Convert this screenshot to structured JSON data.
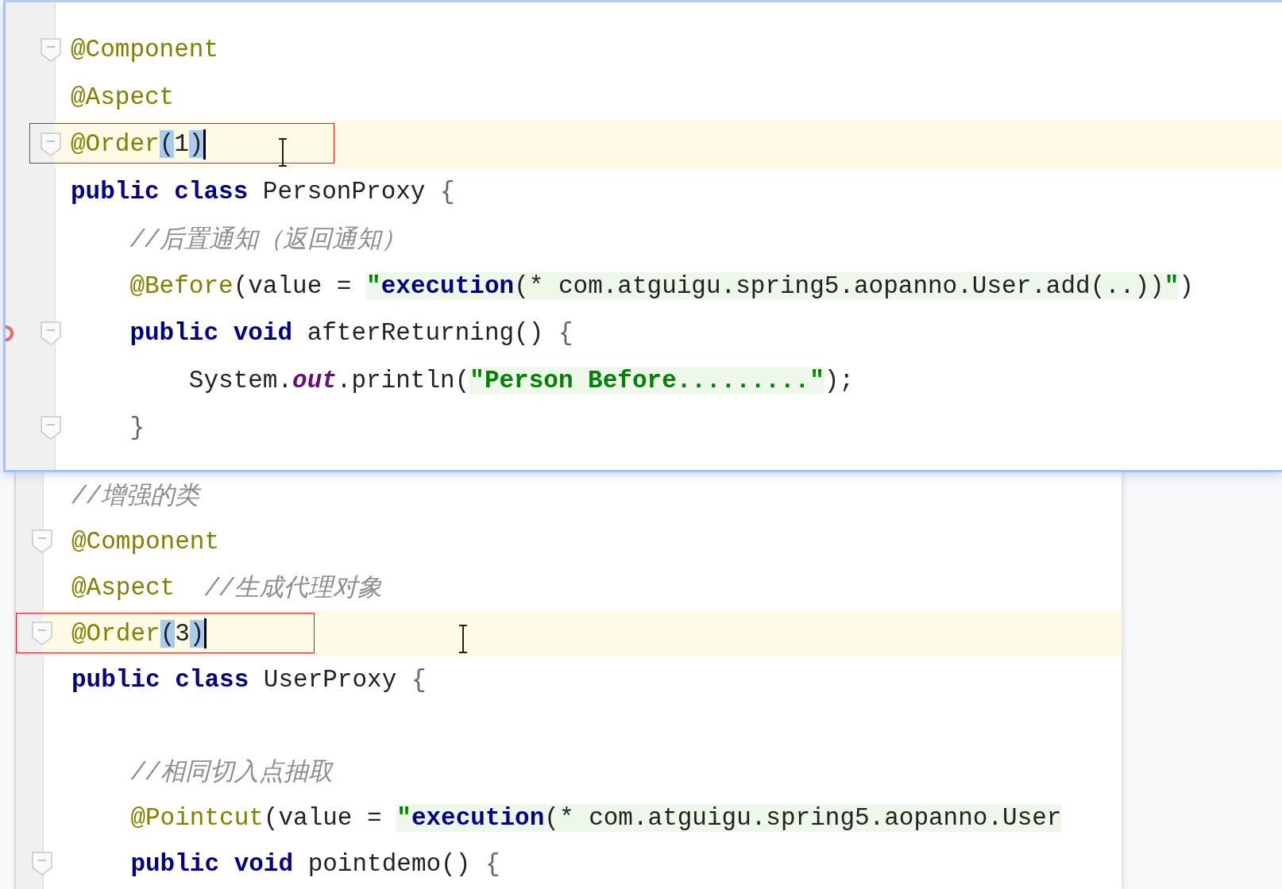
{
  "panes": [
    {
      "lines": [
        {
          "fold": true,
          "current": false,
          "framed": false,
          "pointer": false,
          "gutter_icon": false,
          "tokens": [
            {
              "kind": "annotation",
              "text": "@Component"
            }
          ]
        },
        {
          "fold": false,
          "current": false,
          "framed": false,
          "pointer": false,
          "gutter_icon": false,
          "tokens": [
            {
              "kind": "annotation",
              "text": "@Aspect"
            }
          ]
        },
        {
          "fold": true,
          "current": true,
          "framed": true,
          "pointer": true,
          "gutter_icon": false,
          "tokens": [
            {
              "kind": "annotation",
              "text": "@Order"
            },
            {
              "kind": "match",
              "text": "("
            },
            {
              "kind": "number",
              "text": "1"
            },
            {
              "kind": "match",
              "text": ")"
            }
          ]
        },
        {
          "fold": false,
          "current": false,
          "framed": false,
          "pointer": false,
          "gutter_icon": false,
          "tokens": [
            {
              "kind": "keyword",
              "text": "public class "
            },
            {
              "kind": "plain",
              "text": "PersonProxy "
            },
            {
              "kind": "brace",
              "text": "{"
            }
          ]
        },
        {
          "fold": false,
          "current": false,
          "framed": false,
          "pointer": false,
          "gutter_icon": false,
          "tokens": [
            {
              "kind": "comment",
              "text": "    //后置通知（返回通知）"
            }
          ]
        },
        {
          "fold": false,
          "current": false,
          "framed": false,
          "pointer": false,
          "gutter_icon": false,
          "tokens": [
            {
              "kind": "annotation",
              "text": "    @Before"
            },
            {
              "kind": "plain",
              "text": "(value = "
            },
            {
              "kind": "string",
              "text": "\""
            },
            {
              "kind": "string-keyword",
              "text": "execution"
            },
            {
              "kind": "string-code",
              "text": "(* com.atguigu.spring5.aopanno.User.add(..))"
            },
            {
              "kind": "string",
              "text": "\""
            },
            {
              "kind": "plain",
              "text": ")"
            }
          ]
        },
        {
          "fold": true,
          "current": false,
          "framed": false,
          "pointer": false,
          "gutter_icon": true,
          "tokens": [
            {
              "kind": "keyword",
              "text": "    public void "
            },
            {
              "kind": "plain",
              "text": "afterReturning() "
            },
            {
              "kind": "brace",
              "text": "{"
            }
          ]
        },
        {
          "fold": false,
          "current": false,
          "framed": false,
          "pointer": false,
          "gutter_icon": false,
          "tokens": [
            {
              "kind": "plain",
              "text": "        System."
            },
            {
              "kind": "field",
              "text": "out"
            },
            {
              "kind": "plain",
              "text": ".println("
            },
            {
              "kind": "string",
              "text": "\"Person Before.........\""
            },
            {
              "kind": "plain",
              "text": ");"
            }
          ]
        },
        {
          "fold": true,
          "current": false,
          "framed": false,
          "pointer": false,
          "gutter_icon": false,
          "tokens": [
            {
              "kind": "brace",
              "text": "    }"
            }
          ]
        }
      ]
    },
    {
      "lines": [
        {
          "fold": false,
          "current": false,
          "framed": false,
          "pointer": false,
          "gutter_icon": false,
          "tokens": [
            {
              "kind": "comment",
              "text": "//增强的类"
            }
          ]
        },
        {
          "fold": true,
          "current": false,
          "framed": false,
          "pointer": false,
          "gutter_icon": false,
          "tokens": [
            {
              "kind": "annotation",
              "text": "@Component"
            }
          ]
        },
        {
          "fold": false,
          "current": false,
          "framed": false,
          "pointer": false,
          "gutter_icon": false,
          "tokens": [
            {
              "kind": "annotation",
              "text": "@Aspect"
            },
            {
              "kind": "comment",
              "text": "  //生成代理对象"
            }
          ]
        },
        {
          "fold": true,
          "current": true,
          "framed": true,
          "pointer": true,
          "gutter_icon": false,
          "tokens": [
            {
              "kind": "annotation",
              "text": "@Order"
            },
            {
              "kind": "match",
              "text": "("
            },
            {
              "kind": "number",
              "text": "3"
            },
            {
              "kind": "match",
              "text": ")"
            }
          ]
        },
        {
          "fold": false,
          "current": false,
          "framed": false,
          "pointer": false,
          "gutter_icon": false,
          "tokens": [
            {
              "kind": "keyword",
              "text": "public class "
            },
            {
              "kind": "plain",
              "text": "UserProxy "
            },
            {
              "kind": "brace",
              "text": "{"
            }
          ]
        },
        {
          "fold": false,
          "current": false,
          "framed": false,
          "pointer": false,
          "gutter_icon": false
        },
        {
          "fold": false,
          "current": false,
          "framed": false,
          "pointer": false,
          "gutter_icon": false,
          "tokens": [
            {
              "kind": "comment",
              "text": "    //相同切入点抽取"
            }
          ]
        },
        {
          "fold": false,
          "current": false,
          "framed": false,
          "pointer": false,
          "gutter_icon": false,
          "tokens": [
            {
              "kind": "annotation",
              "text": "    @Pointcut"
            },
            {
              "kind": "plain",
              "text": "(value = "
            },
            {
              "kind": "string",
              "text": "\""
            },
            {
              "kind": "string-keyword",
              "text": "execution"
            },
            {
              "kind": "string-code",
              "text": "(* com.atguigu.spring5.aopanno.User"
            }
          ]
        },
        {
          "fold": true,
          "current": false,
          "framed": false,
          "pointer": false,
          "gutter_icon": false,
          "tokens": [
            {
              "kind": "keyword",
              "text": "    public void "
            },
            {
              "kind": "plain",
              "text": "pointdemo() "
            },
            {
              "kind": "brace",
              "text": "{"
            }
          ]
        }
      ]
    }
  ]
}
